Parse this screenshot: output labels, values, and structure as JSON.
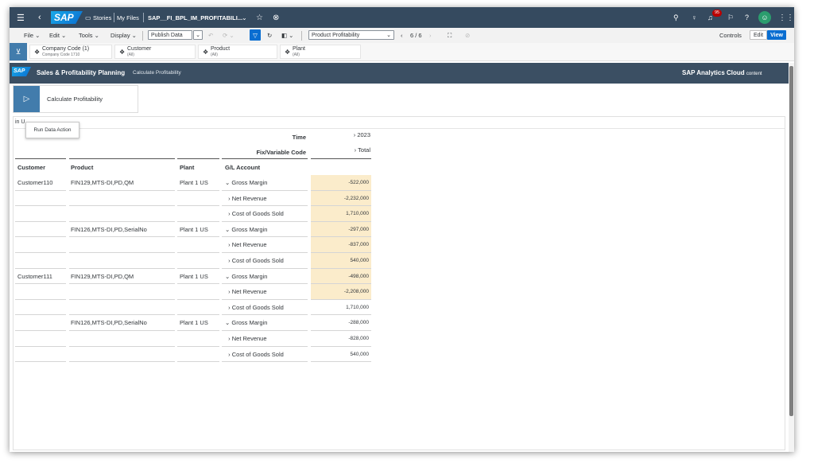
{
  "shell": {
    "logo": "SAP",
    "stories": "Stories",
    "my_files": "My Files",
    "file_name": "SAP__FI_BPL_IM_PROFITABILI...",
    "notif_count": "95"
  },
  "toolbar": {
    "file": "File",
    "edit": "Edit",
    "tools": "Tools",
    "display": "Display",
    "publish": "Publish Data",
    "page_select": "Product Profitability",
    "page_nav": "6 / 6",
    "controls": "Controls",
    "edit_btn": "Edit",
    "view_btn": "View"
  },
  "filters": [
    {
      "label": "Company Code (1)",
      "value": "Company Code 1710"
    },
    {
      "label": "Customer",
      "value": "(All)"
    },
    {
      "label": "Product",
      "value": "(All)"
    },
    {
      "label": "Plant",
      "value": "(All)"
    }
  ],
  "header": {
    "logo": "SAP",
    "title": "Sales & Profitability Planning",
    "subtitle": "Calculate Profitability",
    "right_title": "SAP Analytics Cloud",
    "right_sub": "content"
  },
  "action": {
    "label": "Calculate Profitability",
    "tooltip": "Run Data Action"
  },
  "table": {
    "unit_prefix": "in U",
    "time_label": "Time",
    "time_value": "2023",
    "fix_label": "Fix/Variable Code",
    "fix_value": "Total",
    "col_customer": "Customer",
    "col_product": "Product",
    "col_plant": "Plant",
    "col_gl": "G/L Account",
    "rows": [
      {
        "customer": "Customer110",
        "product": "FIN129,MTS-DI,PD,QM",
        "plant": "Plant 1 US",
        "gl": "Gross Margin",
        "value": "-522,000",
        "hl": true,
        "expanded": true
      },
      {
        "customer": "",
        "product": "",
        "plant": "",
        "gl": "Net Revenue",
        "value": "-2,232,000",
        "hl": true,
        "expanded": false
      },
      {
        "customer": "",
        "product": "",
        "plant": "",
        "gl": "Cost of Goods Sold",
        "value": "1,710,000",
        "hl": true,
        "expanded": false
      },
      {
        "customer": "",
        "product": "FIN126,MTS-DI,PD,SerialNo",
        "plant": "Plant 1 US",
        "gl": "Gross Margin",
        "value": "-297,000",
        "hl": true,
        "expanded": true
      },
      {
        "customer": "",
        "product": "",
        "plant": "",
        "gl": "Net Revenue",
        "value": "-837,000",
        "hl": true,
        "expanded": false
      },
      {
        "customer": "",
        "product": "",
        "plant": "",
        "gl": "Cost of Goods Sold",
        "value": "540,000",
        "hl": true,
        "expanded": false
      },
      {
        "customer": "Customer111",
        "product": "FIN129,MTS-DI,PD,QM",
        "plant": "Plant 1 US",
        "gl": "Gross Margin",
        "value": "-498,000",
        "hl": true,
        "expanded": true
      },
      {
        "customer": "",
        "product": "",
        "plant": "",
        "gl": "Net Revenue",
        "value": "-2,208,000",
        "hl": true,
        "expanded": false
      },
      {
        "customer": "",
        "product": "",
        "plant": "",
        "gl": "Cost of Goods Sold",
        "value": "1,710,000",
        "hl": false,
        "expanded": false
      },
      {
        "customer": "",
        "product": "FIN126,MTS-DI,PD,SerialNo",
        "plant": "Plant 1 US",
        "gl": "Gross Margin",
        "value": "-288,000",
        "hl": false,
        "expanded": true
      },
      {
        "customer": "",
        "product": "",
        "plant": "",
        "gl": "Net Revenue",
        "value": "-828,000",
        "hl": false,
        "expanded": false
      },
      {
        "customer": "",
        "product": "",
        "plant": "",
        "gl": "Cost of Goods Sold",
        "value": "540,000",
        "hl": false,
        "expanded": false
      }
    ]
  },
  "colors": {
    "shell": "#354a5f",
    "header": "#3b4f63",
    "accent": "#427cac",
    "highlight": "#fbeccb",
    "avatar": "#2b9d6e",
    "badge": "#bb0000"
  }
}
